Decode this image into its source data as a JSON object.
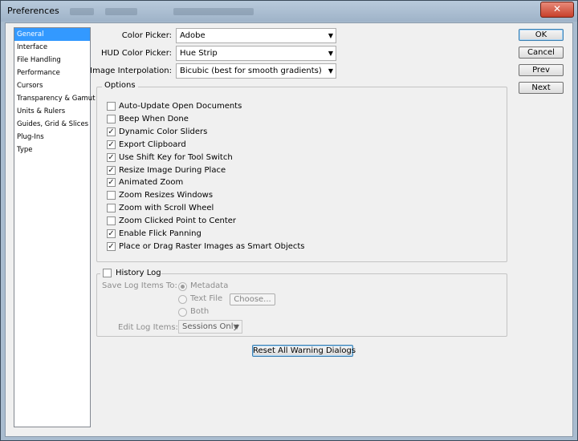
{
  "window": {
    "title": "Preferences",
    "close_glyph": "✕"
  },
  "categories": [
    {
      "label": "General",
      "selected": true
    },
    {
      "label": "Interface"
    },
    {
      "label": "File Handling"
    },
    {
      "label": "Performance"
    },
    {
      "label": "Cursors"
    },
    {
      "label": "Transparency & Gamut"
    },
    {
      "label": "Units & Rulers"
    },
    {
      "label": "Guides, Grid & Slices"
    },
    {
      "label": "Plug-Ins"
    },
    {
      "label": "Type"
    }
  ],
  "fields": {
    "color_picker": {
      "label": "Color Picker:",
      "value": "Adobe"
    },
    "hud_color_picker": {
      "label": "HUD Color Picker:",
      "value": "Hue Strip"
    },
    "image_interpolation": {
      "label": "Image Interpolation:",
      "value": "Bicubic (best for smooth gradients)"
    }
  },
  "options": {
    "title": "Options",
    "items": [
      {
        "label": "Auto-Update Open Documents",
        "checked": false
      },
      {
        "label": "Beep When Done",
        "checked": false
      },
      {
        "label": "Dynamic Color Sliders",
        "checked": true
      },
      {
        "label": "Export Clipboard",
        "checked": true
      },
      {
        "label": "Use Shift Key for Tool Switch",
        "checked": true
      },
      {
        "label": "Resize Image During Place",
        "checked": true
      },
      {
        "label": "Animated Zoom",
        "checked": true
      },
      {
        "label": "Zoom Resizes Windows",
        "checked": false
      },
      {
        "label": "Zoom with Scroll Wheel",
        "checked": false
      },
      {
        "label": "Zoom Clicked Point to Center",
        "checked": false
      },
      {
        "label": "Enable Flick Panning",
        "checked": true
      },
      {
        "label": "Place or Drag Raster Images as Smart Objects",
        "checked": true
      }
    ]
  },
  "history_log": {
    "title": "History Log",
    "checked": false,
    "save_label": "Save Log Items To:",
    "save_options": [
      {
        "label": "Metadata",
        "selected": true
      },
      {
        "label": "Text File",
        "selected": false
      },
      {
        "label": "Both",
        "selected": false
      }
    ],
    "choose_label": "Choose...",
    "edit_label": "Edit Log Items:",
    "edit_value": "Sessions Only"
  },
  "reset_label": "Reset All Warning Dialogs",
  "buttons": {
    "ok": "OK",
    "cancel": "Cancel",
    "prev": "Prev",
    "next": "Next"
  },
  "check_glyph": "✓",
  "arrow_glyph": "▼"
}
